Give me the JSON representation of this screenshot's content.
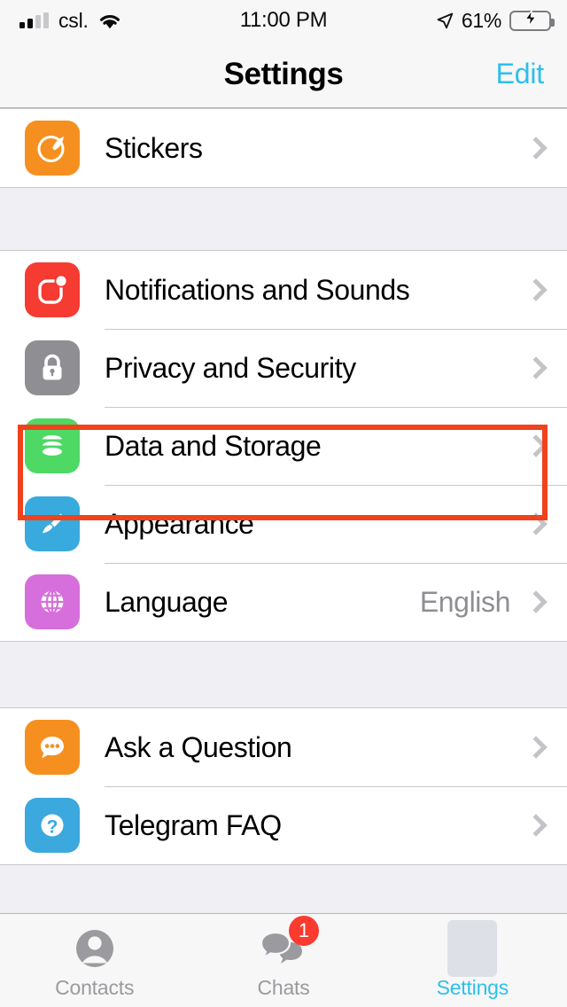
{
  "status_bar": {
    "carrier": "csl.",
    "time": "11:00 PM",
    "battery_percent": "61%",
    "signal_icon": "cellular-bars-icon",
    "wifi_icon": "wifi-icon",
    "location_icon": "location-arrow-icon",
    "battery_icon": "battery-charging-icon",
    "battery_level": 61,
    "battery_color": "#34C759"
  },
  "navbar": {
    "title": "Settings",
    "edit_label": "Edit",
    "accent_color": "#2CC0EC"
  },
  "sections": [
    {
      "rows": [
        {
          "label": "Stickers",
          "icon": "stickers-icon",
          "icon_color": "#F59020",
          "value": "",
          "chevron": true
        }
      ]
    },
    {
      "rows": [
        {
          "label": "Notifications and Sounds",
          "icon": "notifications-icon",
          "icon_color": "#F53B32",
          "value": "",
          "chevron": true
        },
        {
          "label": "Privacy and Security",
          "icon": "lock-icon",
          "icon_color": "#8E8E93",
          "value": "",
          "chevron": true,
          "highlighted": true
        },
        {
          "label": "Data and Storage",
          "icon": "database-icon",
          "icon_color": "#4ED964",
          "value": "",
          "chevron": true
        },
        {
          "label": "Appearance",
          "icon": "paintbrush-icon",
          "icon_color": "#38AADE",
          "value": "",
          "chevron": true
        },
        {
          "label": "Language",
          "icon": "globe-icon",
          "icon_color": "#D66FDC",
          "value": "English",
          "chevron": true
        }
      ]
    },
    {
      "rows": [
        {
          "label": "Ask a Question",
          "icon": "chat-bubble-icon",
          "icon_color": "#F59020",
          "value": "",
          "chevron": true
        },
        {
          "label": "Telegram FAQ",
          "icon": "question-mark-icon",
          "icon_color": "#3BA8DE",
          "value": "",
          "chevron": true
        }
      ]
    }
  ],
  "highlight": {
    "target": "Privacy and Security",
    "color": "#F0421C"
  },
  "tabbar": {
    "tabs": [
      {
        "label": "Contacts",
        "icon": "person-icon",
        "active": false,
        "badge": ""
      },
      {
        "label": "Chats",
        "icon": "chats-bubbles-icon",
        "active": false,
        "badge": "1"
      },
      {
        "label": "Settings",
        "icon": "settings-avatar-icon",
        "active": true,
        "badge": ""
      }
    ],
    "active_color": "#2CC0EC",
    "inactive_color": "#9A9A9F",
    "badge_color": "#FB3B30"
  }
}
